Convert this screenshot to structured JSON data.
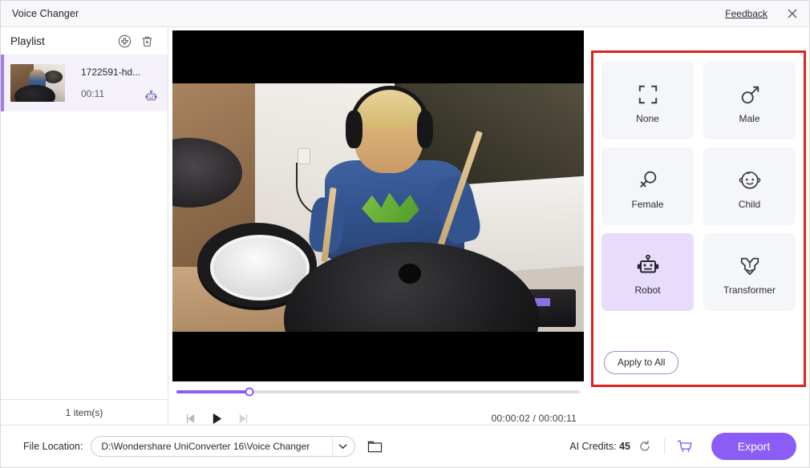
{
  "window": {
    "title": "Voice Changer",
    "feedback_label": "Feedback",
    "close_icon": "close-icon"
  },
  "playlist": {
    "title": "Playlist",
    "add_icon": "add-circle-icon",
    "delete_icon": "trash-icon",
    "items": [
      {
        "name": "1722591-hd...",
        "duration": "00:11",
        "effect_icon": "robot-icon",
        "selected": true
      }
    ],
    "count_label": "1 item(s)"
  },
  "player": {
    "progress_percent": 18,
    "current_time": "00:00:02",
    "total_time": "00:00:11",
    "time_display": "00:00:02 / 00:00:11",
    "prev_icon": "previous-frame-icon",
    "play_icon": "play-icon",
    "next_icon": "next-frame-icon",
    "accent_color": "#8b5cf6"
  },
  "effects": {
    "highlight_color": "#e02320",
    "selected_card_color": "#e7dcfb",
    "cards": [
      {
        "label": "None",
        "icon": "none-frame-icon",
        "selected": false
      },
      {
        "label": "Male",
        "icon": "male-icon",
        "selected": false
      },
      {
        "label": "Female",
        "icon": "female-icon",
        "selected": false
      },
      {
        "label": "Child",
        "icon": "child-face-icon",
        "selected": false
      },
      {
        "label": "Robot",
        "icon": "robot-icon",
        "selected": true
      },
      {
        "label": "Transformer",
        "icon": "transformer-icon",
        "selected": false
      }
    ],
    "apply_to_all_label": "Apply to All"
  },
  "bottom": {
    "file_location_label": "File Location:",
    "file_location_value": "D:\\Wondershare UniConverter 16\\Voice Changer",
    "dropdown_icon": "chevron-down-icon",
    "folder_icon": "folder-icon",
    "credits_prefix": "AI Credits:",
    "credits_value": "45",
    "refresh_icon": "refresh-icon",
    "cart_icon": "cart-icon",
    "export_label": "Export",
    "export_color": "#8b5cf6"
  }
}
